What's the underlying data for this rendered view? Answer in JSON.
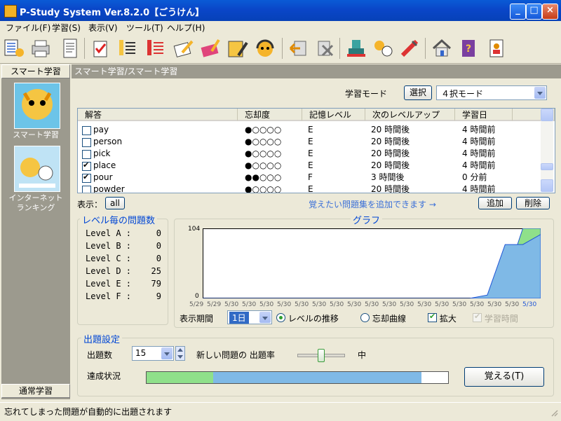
{
  "window": {
    "title": "P-Study System Ver.8.2.0【ごうけん】"
  },
  "menu": [
    "ファイル(F)",
    "学習(S)",
    "表示(V)",
    "ツール(T)",
    "ヘルプ(H)"
  ],
  "left": {
    "top_tab": "スマート学習",
    "item1": "スマート学習",
    "item2_l1": "インターネット",
    "item2_l2": "ランキング",
    "bottom_tab": "通常学習"
  },
  "breadcrumb": "スマート学習/スマート学習",
  "mode": {
    "label": "学習モード",
    "button": "選択",
    "value": "４択モード"
  },
  "table": {
    "headers": [
      "解答",
      "忘却度",
      "記憶レベル",
      "次のレベルアップ",
      "学習日"
    ],
    "rows": [
      {
        "checked": false,
        "word": "pay",
        "forget": "●○○○○",
        "level": "E",
        "next": "20 時間後",
        "date": "4 時間前"
      },
      {
        "checked": false,
        "word": "person",
        "forget": "●○○○○",
        "level": "E",
        "next": "20 時間後",
        "date": "4 時間前"
      },
      {
        "checked": false,
        "word": "pick",
        "forget": "●○○○○",
        "level": "E",
        "next": "20 時間後",
        "date": "4 時間前"
      },
      {
        "checked": true,
        "word": "place",
        "forget": "●○○○○",
        "level": "E",
        "next": "20 時間後",
        "date": "4 時間前"
      },
      {
        "checked": true,
        "word": "pour",
        "forget": "●●○○○",
        "level": "F",
        "next": "3 時間後",
        "date": "0 分前"
      },
      {
        "checked": false,
        "word": "powder",
        "forget": "●○○○○",
        "level": "E",
        "next": "20 時間後",
        "date": "4 時間前"
      }
    ]
  },
  "display": {
    "label": "表示：",
    "button": "all",
    "hint": "覚えたい問題集を追加できます →",
    "add": "追加",
    "remove": "削除"
  },
  "levels": {
    "title": "レベル毎の問題数",
    "items": [
      {
        "name": "Level A :",
        "count": "0"
      },
      {
        "name": "Level B :",
        "count": "0"
      },
      {
        "name": "Level C :",
        "count": "0"
      },
      {
        "name": "Level D :",
        "count": "25"
      },
      {
        "name": "Level E :",
        "count": "79"
      },
      {
        "name": "Level F :",
        "count": "9"
      }
    ]
  },
  "graph": {
    "title": "グラフ",
    "ymax_label": "104",
    "ymin_label": "0",
    "x_labels": [
      "5/29",
      "5/29",
      "5/30",
      "5/30",
      "5/30",
      "5/30",
      "5/30",
      "5/30",
      "5/30",
      "5/30",
      "5/30",
      "5/30",
      "5/30",
      "5/30",
      "5/30",
      "5/30",
      "5/30",
      "5/30",
      "5/30",
      "5/30"
    ],
    "period_label": "表示期間",
    "period_value": "1日",
    "radio1": "レベルの推移",
    "radio2": "忘却曲線",
    "check1": "拡大",
    "check2": "学習時間",
    "colors": {
      "green": "#8fe08a",
      "blue": "#7fb9e6"
    }
  },
  "chart_data": {
    "type": "area",
    "x": [
      "5/29",
      "5/29",
      "5/30",
      "5/30",
      "5/30",
      "5/30",
      "5/30",
      "5/30",
      "5/30",
      "5/30",
      "5/30",
      "5/30",
      "5/30",
      "5/30",
      "5/30",
      "5/30",
      "5/30",
      "5/30",
      "5/30",
      "5/30"
    ],
    "ylim": [
      0,
      104
    ],
    "series": [
      {
        "values": [
          0,
          0,
          0,
          0,
          0,
          0,
          0,
          0,
          0,
          0,
          0,
          0,
          0,
          0,
          0,
          0,
          0,
          25,
          104,
          104
        ]
      },
      {
        "values": [
          0,
          0,
          0,
          0,
          0,
          0,
          0,
          0,
          0,
          0,
          0,
          0,
          0,
          0,
          0,
          0,
          5,
          80,
          80,
          95
        ]
      }
    ]
  },
  "settings": {
    "title": "出題設定",
    "count_label": "出題数",
    "count_value": "15",
    "new_rate_label": "新しい問題の 出題率",
    "new_rate_value": "中",
    "progress_label": "達成状況",
    "progress_green": 0.22,
    "progress_blue": 0.69,
    "memorize_button": "覚える(T)"
  },
  "status": "忘れてしまった問題が自動的に出題されます"
}
